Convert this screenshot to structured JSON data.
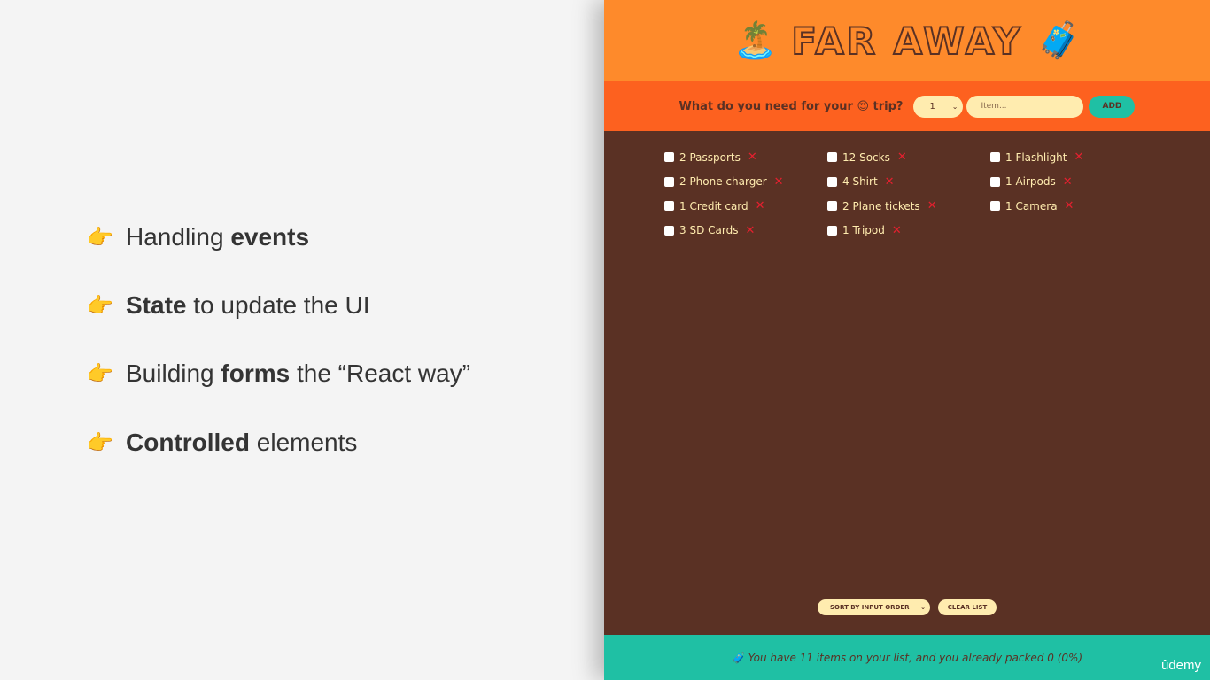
{
  "slide": {
    "bullets": [
      {
        "pre": "Handling ",
        "bold": "events",
        "post": ""
      },
      {
        "pre": "",
        "bold": "State",
        "post": " to update the UI"
      },
      {
        "pre": "Building ",
        "bold": "forms",
        "post": " the “React way”"
      },
      {
        "pre": "",
        "bold": "Controlled",
        "post": " elements"
      }
    ],
    "icon": "pointing-hand-icon"
  },
  "app": {
    "title": "FAR AWAY",
    "logo_left_emoji": "🏝️",
    "logo_right_emoji": "🧳",
    "form": {
      "question": "What do you need for your 😍 trip?",
      "quantity_value": "1",
      "item_placeholder": "Item...",
      "add_label": "ADD"
    },
    "items": [
      "2 Passports",
      "12 Socks",
      "1 Flashlight",
      "2 Phone charger",
      "4 Shirt",
      "1 Airpods",
      "1 Credit card",
      "2 Plane tickets",
      "1 Camera",
      "3 SD Cards",
      "1 Tripod"
    ],
    "delete_glyph": "✕",
    "sort_value": "SORT BY INPUT ORDER",
    "clear_label": "CLEAR LIST",
    "stats": "🧳 You have 11 items on your list, and you already packed 0 (0%)"
  },
  "watermark": "ûdemy",
  "colors": {
    "header": "#fe8a2b",
    "form_bar": "#fd611f",
    "list_bg": "#5a3124",
    "stats_bg": "#1fc0a4",
    "cream": "#ffecaf",
    "delete": "#e4202f"
  }
}
